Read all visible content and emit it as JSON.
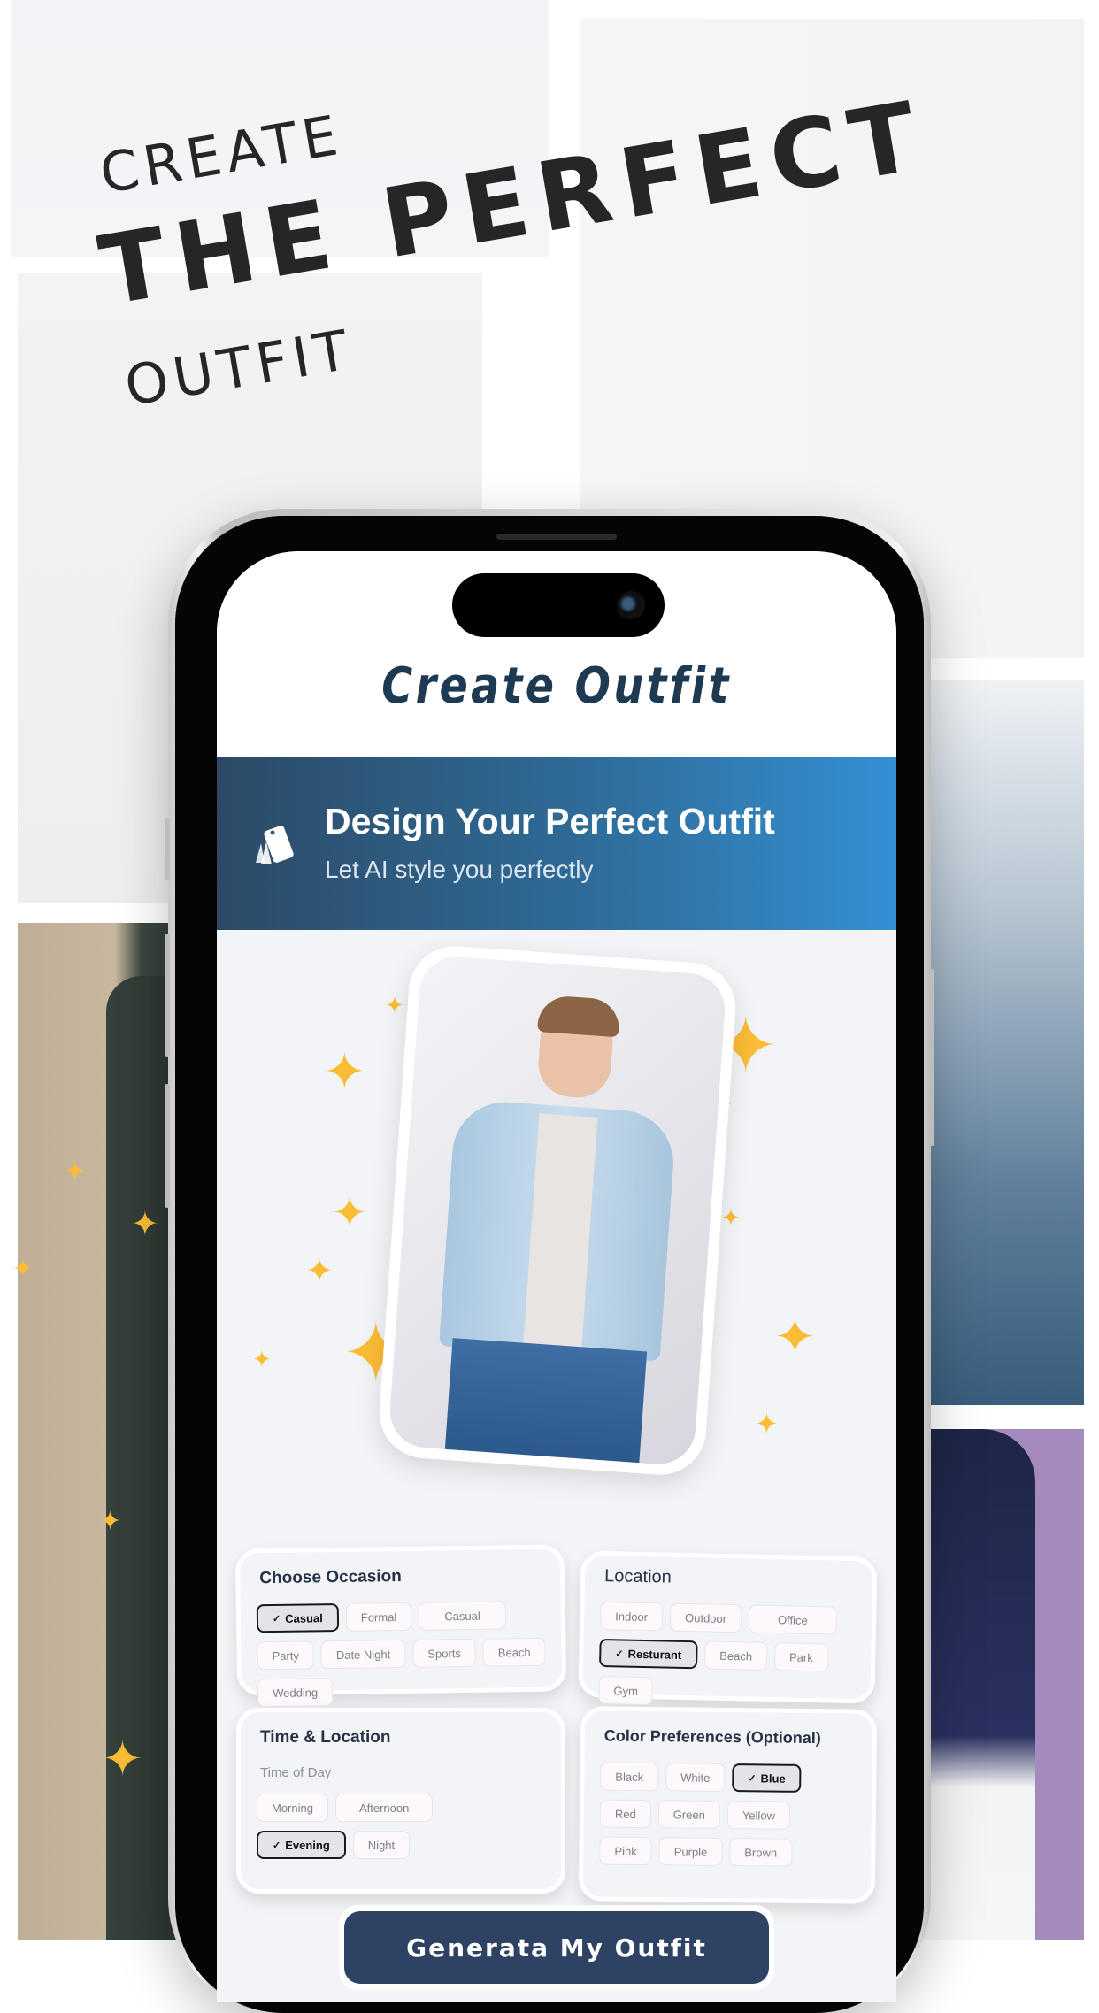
{
  "headline": {
    "line1": "CREATE",
    "line2": "THE PERFECT",
    "line3": "OUTFIT"
  },
  "app": {
    "title": "Create Outfit",
    "banner": {
      "icon": "swatch-cards-icon",
      "title": "Design Your Perfect Outfit",
      "subtitle": "Let AI style you perfectly"
    },
    "photo": {
      "description": "smiling young man in light denim shirt, white t-shirt and blue jeans"
    },
    "occasion": {
      "title": "Choose Occasion",
      "options": [
        {
          "label": "Casual",
          "selected": true
        },
        {
          "label": "Formal",
          "selected": false
        },
        {
          "label": "Casual",
          "selected": false
        },
        {
          "label": "Party",
          "selected": false
        },
        {
          "label": "Date Night",
          "selected": false
        },
        {
          "label": "Sports",
          "selected": false
        },
        {
          "label": "Beach",
          "selected": false
        },
        {
          "label": "Wedding",
          "selected": false
        }
      ]
    },
    "location": {
      "title": "Location",
      "options": [
        {
          "label": "Indoor",
          "selected": false
        },
        {
          "label": "Outdoor",
          "selected": false
        },
        {
          "label": "Office",
          "selected": false
        },
        {
          "label": "Resturant",
          "selected": true
        },
        {
          "label": "Beach",
          "selected": false
        },
        {
          "label": "Park",
          "selected": false
        },
        {
          "label": "Gym",
          "selected": false
        }
      ]
    },
    "time": {
      "title": "Time & Location",
      "sublabel": "Time of Day",
      "options": [
        {
          "label": "Morning",
          "selected": false
        },
        {
          "label": "Afternoon",
          "selected": false
        },
        {
          "label": "Evening",
          "selected": true
        },
        {
          "label": "Night",
          "selected": false
        }
      ]
    },
    "colors": {
      "title": "Color Preferences (Optional)",
      "options": [
        {
          "label": "Black",
          "selected": false
        },
        {
          "label": "White",
          "selected": false
        },
        {
          "label": "Blue",
          "selected": true
        },
        {
          "label": "Red",
          "selected": false
        },
        {
          "label": "Green",
          "selected": false
        },
        {
          "label": "Yellow",
          "selected": false
        },
        {
          "label": "Pink",
          "selected": false
        },
        {
          "label": "Purple",
          "selected": false
        },
        {
          "label": "Brown",
          "selected": false
        }
      ]
    },
    "check_mark": "✓",
    "generate_label": "Generata My Outfit"
  },
  "colors": {
    "accent_dark": "#2e4264",
    "banner_start": "#2c4a66",
    "banner_end": "#3490d4",
    "title_text": "#1e3a52",
    "sparkle": "#fbbc36",
    "chip_bg": "#fdf8fc",
    "chip_selected_bg": "#e6e2ea"
  }
}
